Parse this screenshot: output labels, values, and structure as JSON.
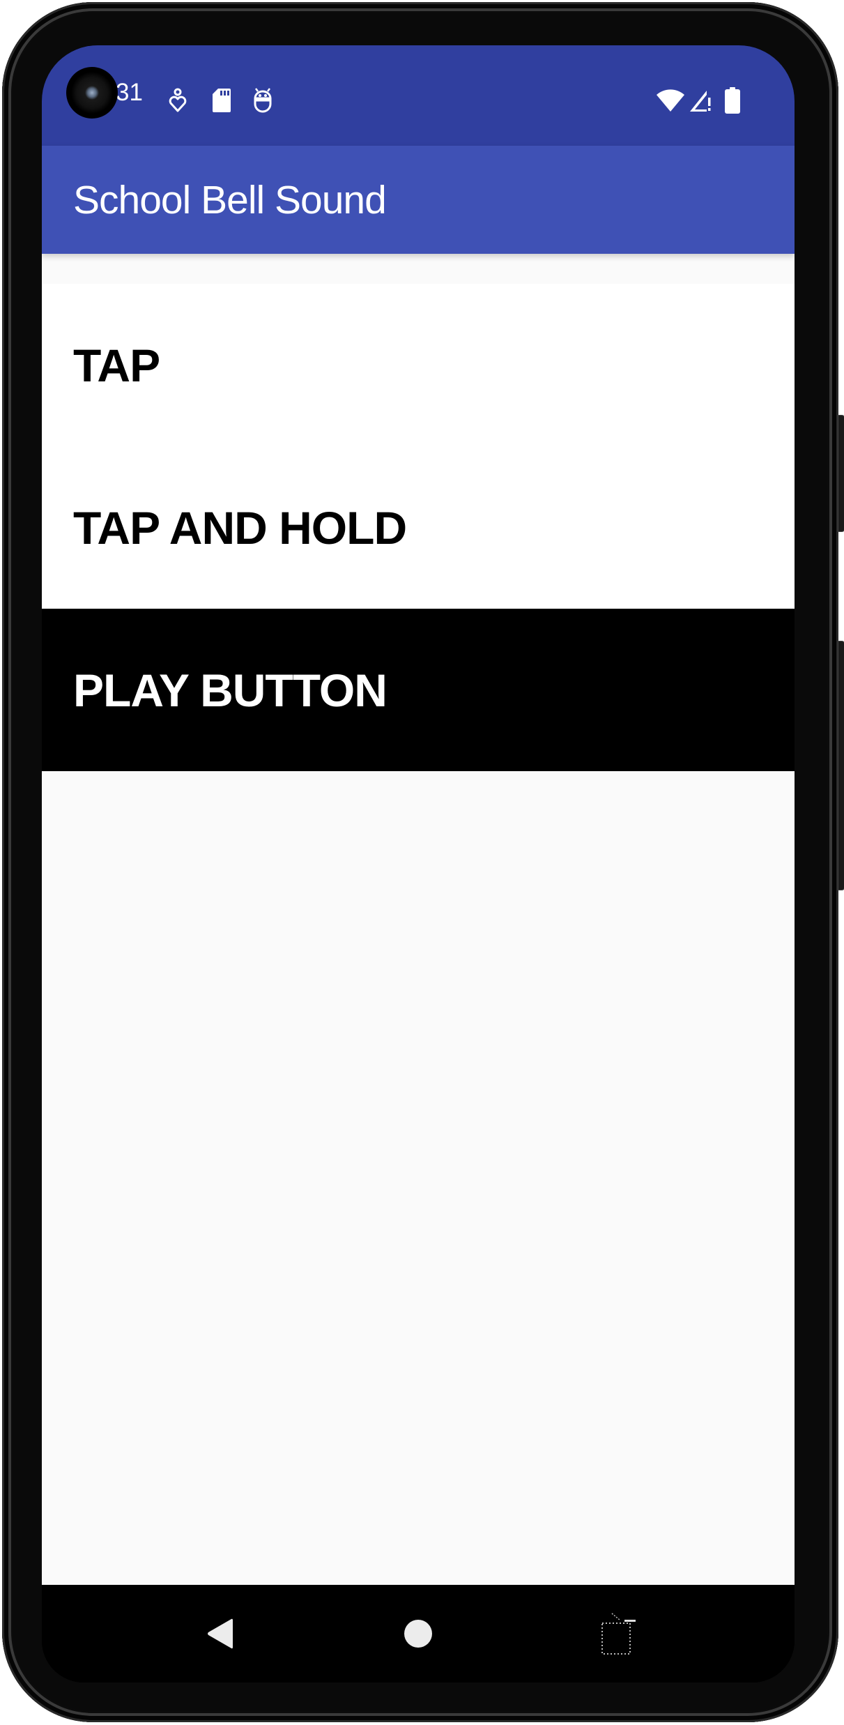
{
  "status_bar": {
    "time_visible": "31",
    "left_icons": [
      "digital-wellbeing-icon",
      "sd-card-icon",
      "debug-robot-icon"
    ],
    "right_icons": [
      "wifi-icon",
      "signal-no-data-icon",
      "battery-icon"
    ],
    "color": "#303F9F"
  },
  "app_bar": {
    "title": "School Bell Sound",
    "color": "#3F51B5"
  },
  "list": {
    "items": [
      {
        "label": "TAP",
        "selected": false
      },
      {
        "label": "TAP AND HOLD",
        "selected": false
      },
      {
        "label": "PLAY BUTTON",
        "selected": true
      }
    ]
  },
  "nav_bar": {
    "buttons": [
      "back",
      "home",
      "recents"
    ]
  },
  "colors": {
    "background": "#FAFAFA",
    "row_background": "#FFFFFF",
    "selected_row_background": "#000000",
    "selected_row_text": "#FFFFFF"
  }
}
